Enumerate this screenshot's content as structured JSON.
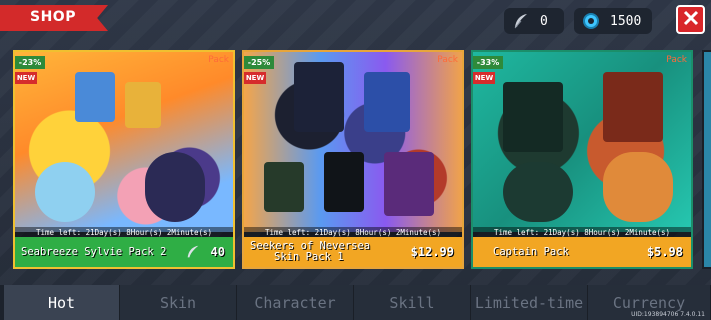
{
  "header": {
    "title": "SHOP",
    "feather_count": "0",
    "gem_count": "1500"
  },
  "cards": [
    {
      "discount": "-23%",
      "new_tag": "NEW",
      "pack_tag": "Pack",
      "time_left": "Time left: 21Day(s) 8Hour(s) 2Minute(s)",
      "title_line1": "Seabreeze Sylvie Pack 2",
      "title_line2": "",
      "price": "40",
      "price_currency_icon": "feather-icon"
    },
    {
      "discount": "-25%",
      "new_tag": "NEW",
      "pack_tag": "Pack",
      "time_left": "Time left: 21Day(s) 8Hour(s) 2Minute(s)",
      "title_line1": "Seekers of Neversea",
      "title_line2": "Skin Pack 1",
      "price": "$12.99"
    },
    {
      "discount": "-33%",
      "new_tag": "NEW",
      "pack_tag": "Pack",
      "time_left": "Time left: 21Day(s) 8Hour(s) 2Minute(s)",
      "title_line1": "Captain Pack",
      "title_line2": "",
      "price": "$5.98"
    }
  ],
  "tabs": [
    {
      "label": "Hot",
      "active": true
    },
    {
      "label": "Skin",
      "active": false
    },
    {
      "label": "Character",
      "active": false
    },
    {
      "label": "Skill",
      "active": false
    },
    {
      "label": "Limited-time",
      "active": false
    },
    {
      "label": "Currency",
      "active": false
    }
  ],
  "footer": {
    "uid": "UID:193894706 7.4.0.11"
  },
  "colors": {
    "accent_red": "#d32a2a",
    "gem_cyan": "#3fc6ff",
    "green_bar": "#2fae45",
    "orange_bar": "#f2a623"
  }
}
